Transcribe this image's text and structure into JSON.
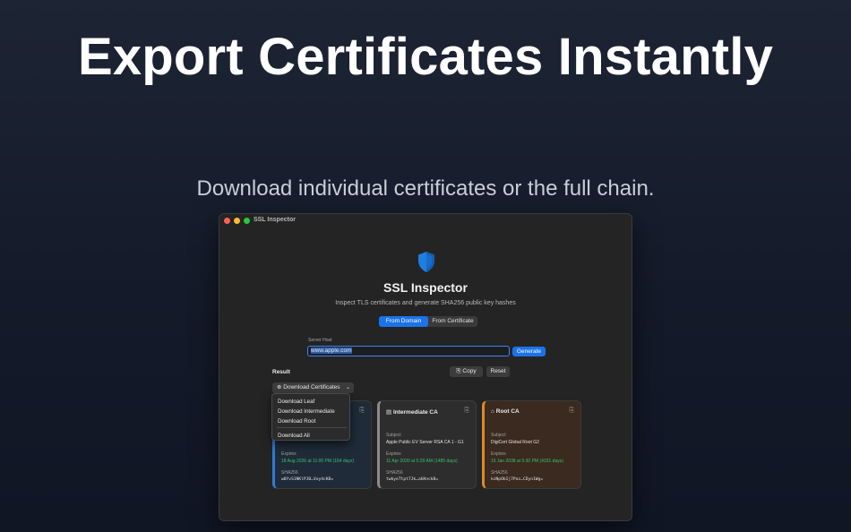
{
  "hero": {
    "title": "Export Certificates Instantly",
    "subtitle": "Download individual certificates or the full chain."
  },
  "window": {
    "title": "SSL Inspector"
  },
  "app": {
    "title": "SSL Inspector",
    "subtitle": "Inspect TLS certificates and generate SHA256 public key hashes",
    "tabs": [
      {
        "label": "From Domain",
        "active": true
      },
      {
        "label": "From Certificate",
        "active": false
      }
    ],
    "server_host_label": "Server Host",
    "server_host_value": "www.apple.com",
    "generate_label": "Generate",
    "result_label": "Result",
    "copy_label": "Copy",
    "reset_label": "Reset",
    "download_label": "Download Certificates"
  },
  "menu": {
    "items": [
      "Download Leaf",
      "Download Intermediate",
      "Download Root",
      "Download All"
    ]
  },
  "cards": {
    "leaf": {
      "expires_label": "Expires",
      "expires_value": "18 Aug 2026 at 11:00 PM (164 days)",
      "sha_label": "SHA256",
      "sha_value": "w0YvS1NKlPJB…Voy4cKB="
    },
    "intermediate": {
      "title": "Intermediate CA",
      "subject_label": "Subject",
      "subject_value": "Apple Public EV Server RSA CA 1 - G1",
      "expires_label": "Expires",
      "expires_value": "11 Apr 2030 at 5:29 AM (1485 days)",
      "sha_label": "SHA256",
      "sha_value": "twbyeTtpt7Jk…aHAnckB="
    },
    "root": {
      "title": "Root CA",
      "subject_label": "Subject",
      "subject_value": "DigiCert Global Root G2",
      "expires_label": "Expires",
      "expires_value": "15 Jan 2038 at 5:30 PM (4331 days)",
      "sha_label": "SHA256",
      "sha_value": "kzNpObIj7Paz…CDyn1Wg="
    }
  },
  "colors": {
    "accent": "#1a73e8",
    "leaf": "#2e7bd6",
    "root": "#d9892d",
    "expires_green": "#39c16c"
  }
}
